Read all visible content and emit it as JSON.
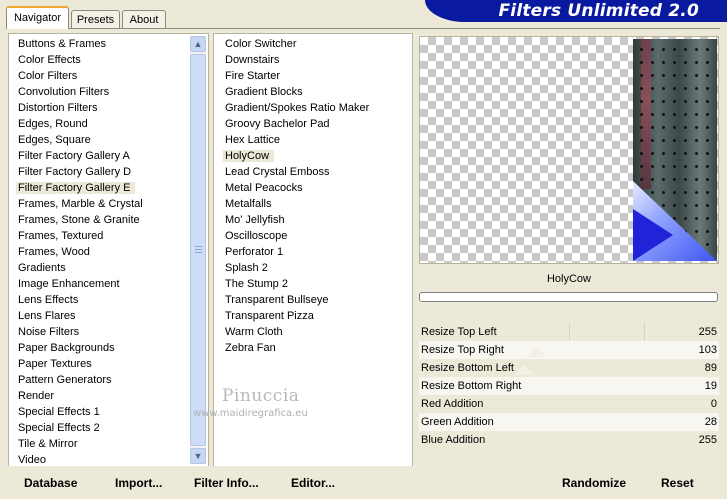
{
  "tabs": [
    "Navigator",
    "Presets",
    "About"
  ],
  "banner_title": "Filters Unlimited 2.0",
  "categories": [
    "Buttons & Frames",
    "Color Effects",
    "Color Filters",
    "Convolution Filters",
    "Distortion Filters",
    "Edges, Round",
    "Edges, Square",
    "Filter Factory Gallery A",
    "Filter Factory Gallery D",
    "Filter Factory Gallery E",
    "Frames, Marble & Crystal",
    "Frames, Stone & Granite",
    "Frames, Textured",
    "Frames, Wood",
    "Gradients",
    "Image Enhancement",
    "Lens Effects",
    "Lens Flares",
    "Noise Filters",
    "Paper Backgrounds",
    "Paper Textures",
    "Pattern Generators",
    "Render",
    "Special Effects 1",
    "Special Effects 2",
    "Tile & Mirror",
    "Video"
  ],
  "selected_category": "Filter Factory Gallery E",
  "filters": [
    "Color Switcher",
    "Downstairs",
    "Fire Starter",
    "Gradient Blocks",
    "Gradient/Spokes Ratio Maker",
    "Groovy Bachelor Pad",
    "Hex Lattice",
    "HolyCow",
    "Lead Crystal Emboss",
    "Metal Peacocks",
    "Metalfalls",
    "Mo' Jellyfish",
    "Oscilloscope",
    "Perforator 1",
    "Splash 2",
    "The Stump 2",
    "Transparent Bullseye",
    "Transparent Pizza",
    "Warm Cloth",
    "Zebra Fan"
  ],
  "selected_filter": "HolyCow",
  "filter_name": "HolyCow",
  "watermark": {
    "name": "Pinuccia",
    "url": "www.maidiregrafica.eu"
  },
  "params": [
    {
      "label": "Resize Top Left",
      "value": "255"
    },
    {
      "label": "Resize Top Right",
      "value": "103"
    },
    {
      "label": "Resize Bottom Left",
      "value": "89"
    },
    {
      "label": "Resize Bottom Right",
      "value": "19"
    },
    {
      "label": "Red Addition",
      "value": "0"
    },
    {
      "label": "Green Addition",
      "value": "28"
    },
    {
      "label": "Blue Addition",
      "value": "255"
    }
  ],
  "buttons": {
    "database": "Database",
    "import": "Import...",
    "filter_info": "Filter Info...",
    "editor": "Editor...",
    "randomize": "Randomize",
    "reset": "Reset"
  }
}
